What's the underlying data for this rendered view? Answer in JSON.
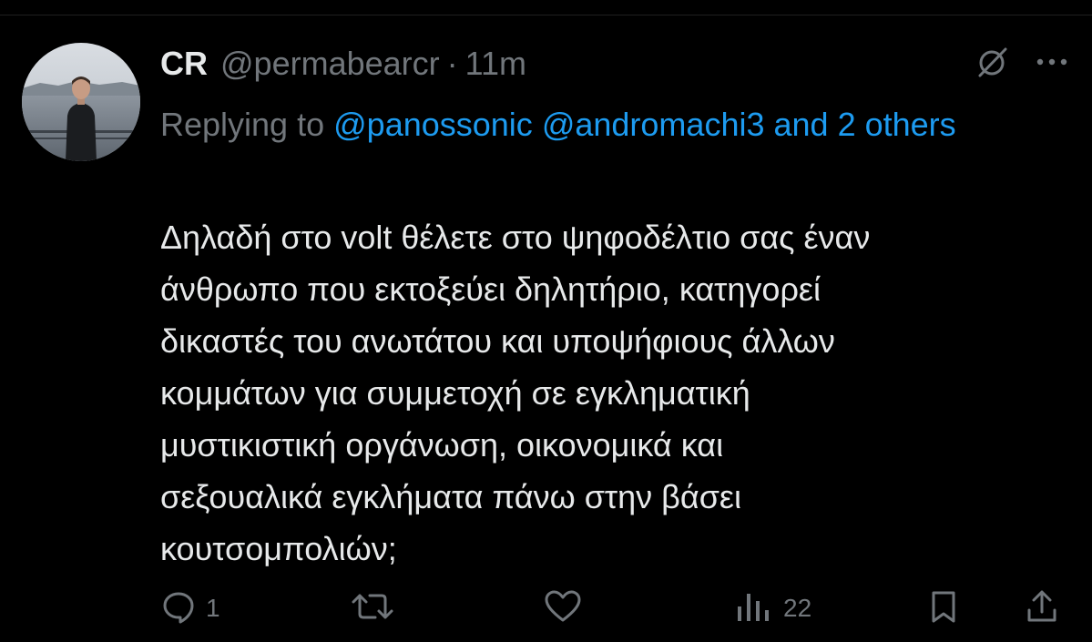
{
  "tweet": {
    "author": {
      "display_name": "CR",
      "handle": "@permabearcr",
      "separator": "·",
      "time": "11m"
    },
    "reply_context": {
      "prefix": "Replying to",
      "mention_1": "@panossonic",
      "mention_2": "@andromachi3",
      "and_others": "and 2 others"
    },
    "text": "Δηλαδή στο volt θέλετε στο ψηφοδέλτιο σας έναν\nάνθρωπο που εκτοξεύει δηλητήριο, κατηγορεί\nδικαστές του ανωτάτου και υποψήφιους άλλων\nκομμάτων για συμμετοχή σε εγκληματική\nμυστικιστική οργάνωση, οικονομικά και\nσεξουαλικά εγκλήματα πάνω στην βάσει\nκουτσομπολιών;",
    "actions": {
      "reply_count": "1",
      "retweet_count": "",
      "like_count": "",
      "views_count": "22"
    }
  },
  "icons": {
    "grok": "slashed-circle-icon",
    "more": "more-dots-icon",
    "reply": "reply-icon",
    "retweet": "retweet-icon",
    "like": "heart-icon",
    "views": "views-icon",
    "bookmark": "bookmark-icon",
    "share": "share-icon"
  },
  "colors": {
    "background": "#000000",
    "text": "#e7e9ea",
    "muted": "#71767b",
    "accent": "#1d9bf0"
  }
}
